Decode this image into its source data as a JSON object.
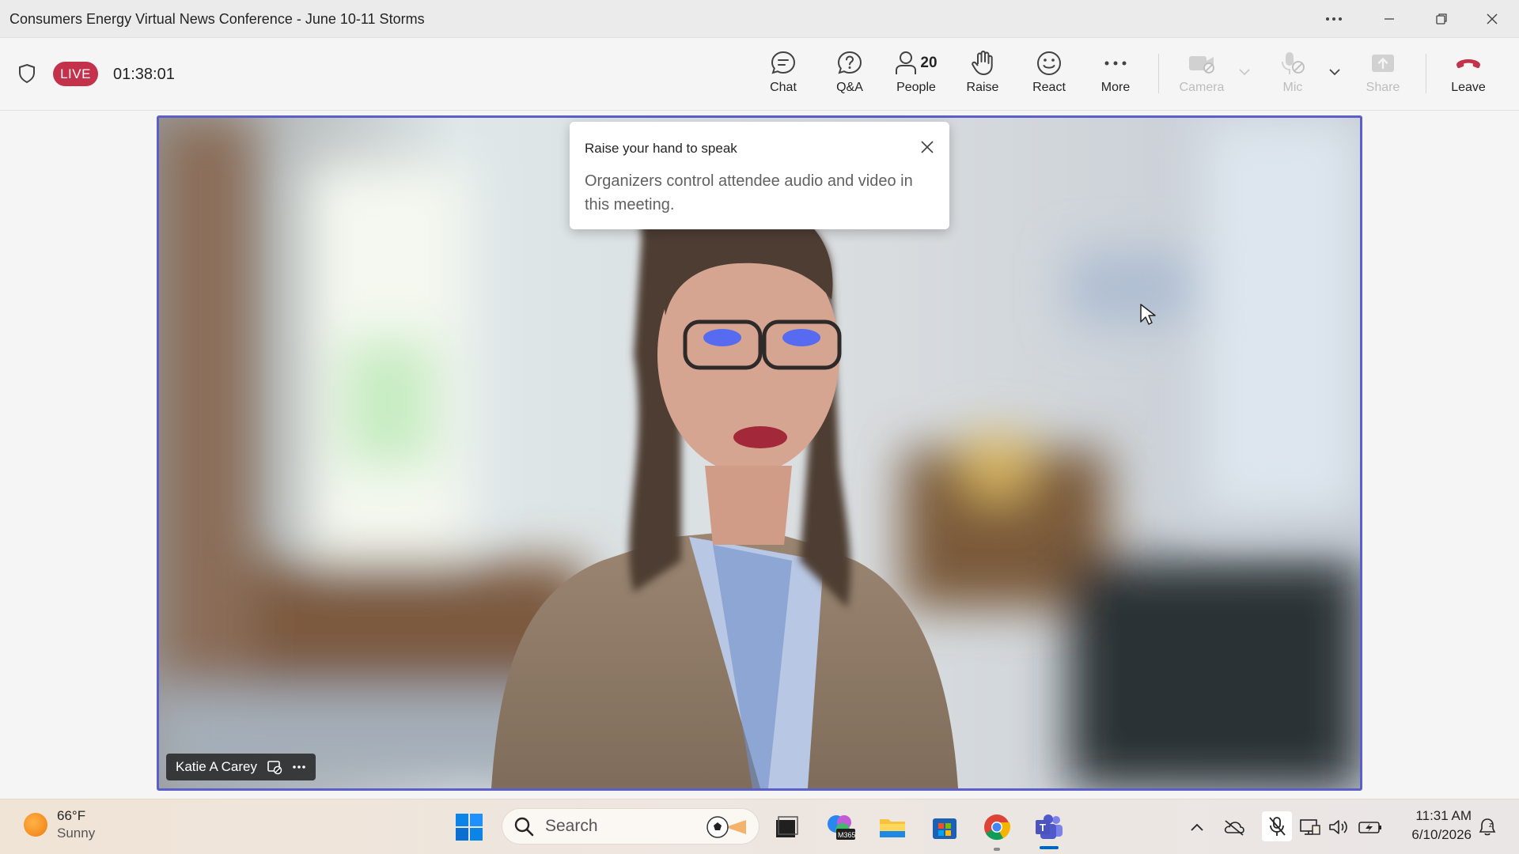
{
  "window": {
    "title": "Consumers Energy Virtual News Conference - June 10-11 Storms"
  },
  "meeting": {
    "live_label": "LIVE",
    "elapsed": "01:38:01"
  },
  "toolbar": {
    "chat": "Chat",
    "qa": "Q&A",
    "people": "People",
    "people_count": "20",
    "raise": "Raise",
    "react": "React",
    "more": "More",
    "camera": "Camera",
    "mic": "Mic",
    "share": "Share",
    "leave": "Leave",
    "leave_color": "#c4314b"
  },
  "popup": {
    "title": "Raise your hand to speak",
    "body": "Organizers control attendee audio and video in this meeting."
  },
  "video": {
    "participant_name": "Katie A Carey",
    "frame_color": "#5b5fc7"
  },
  "taskbar": {
    "weather_temp": "66°F",
    "weather_condition": "Sunny",
    "search_label": "Search",
    "time": "11:31 AM",
    "date": "6/10/2026",
    "apps": [
      "start-icon",
      "file-explorer-icon",
      "m365-icon",
      "folder-icon",
      "store-icon",
      "chrome-icon",
      "teams-icon"
    ]
  }
}
